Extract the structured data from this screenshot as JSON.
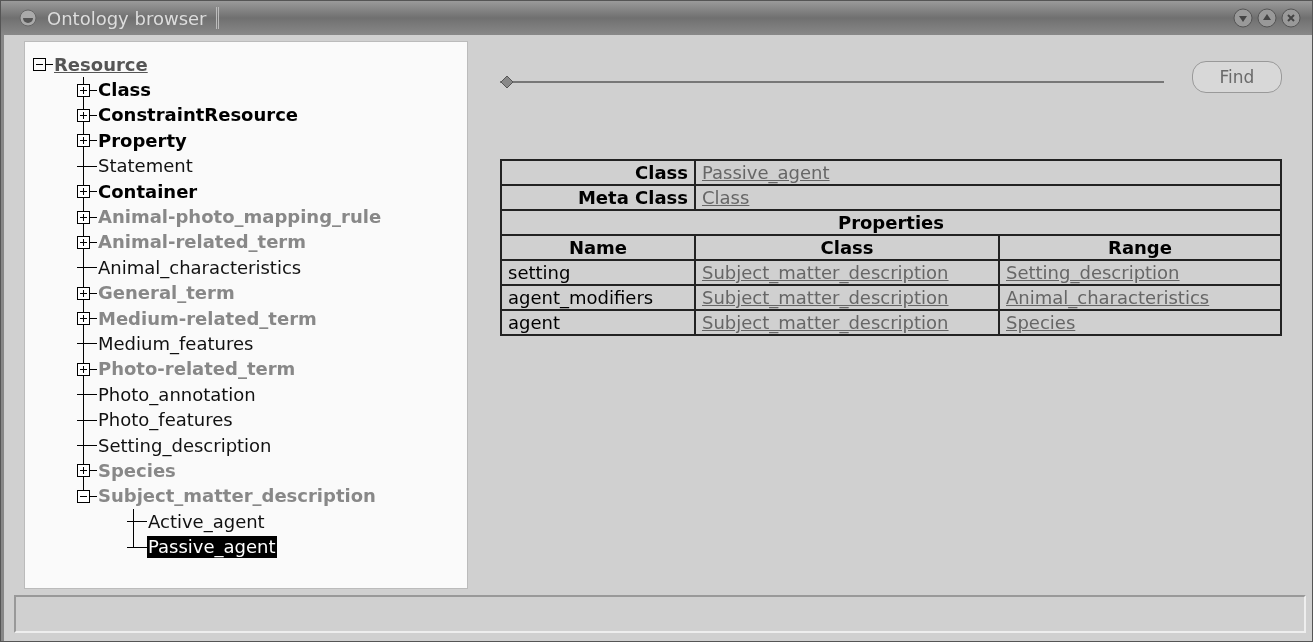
{
  "window": {
    "title": "Ontology browser"
  },
  "tree": {
    "label": "Resource",
    "expanded": true,
    "selected": false,
    "kind": "link",
    "children": [
      {
        "label": "Class",
        "kind": "bold",
        "expanded": false,
        "selected": false
      },
      {
        "label": "ConstraintResource",
        "kind": "bold",
        "expanded": false,
        "selected": false
      },
      {
        "label": "Property",
        "kind": "bold",
        "expanded": false,
        "selected": false
      },
      {
        "label": "Statement",
        "kind": "plain",
        "selected": false
      },
      {
        "label": "Container",
        "kind": "bold",
        "expanded": false,
        "selected": false
      },
      {
        "label": "Animal-photo_mapping_rule",
        "kind": "grey",
        "expanded": false,
        "selected": false
      },
      {
        "label": "Animal-related_term",
        "kind": "grey",
        "expanded": false,
        "selected": false
      },
      {
        "label": "Animal_characteristics",
        "kind": "plain",
        "selected": false
      },
      {
        "label": "General_term",
        "kind": "grey",
        "expanded": false,
        "selected": false
      },
      {
        "label": "Medium-related_term",
        "kind": "grey",
        "expanded": false,
        "selected": false
      },
      {
        "label": "Medium_features",
        "kind": "plain",
        "selected": false
      },
      {
        "label": "Photo-related_term",
        "kind": "grey",
        "expanded": false,
        "selected": false
      },
      {
        "label": "Photo_annotation",
        "kind": "plain",
        "selected": false
      },
      {
        "label": "Photo_features",
        "kind": "plain",
        "selected": false
      },
      {
        "label": "Setting_description",
        "kind": "plain",
        "selected": false
      },
      {
        "label": "Species",
        "kind": "grey",
        "expanded": false,
        "selected": false
      },
      {
        "label": "Subject_matter_description",
        "kind": "grey",
        "expanded": true,
        "selected": false,
        "children": [
          {
            "label": "Active_agent",
            "kind": "plain",
            "selected": false
          },
          {
            "label": "Passive_agent",
            "kind": "plain",
            "selected": true
          }
        ]
      }
    ]
  },
  "search": {
    "level": 0,
    "button": {
      "label": "Find",
      "disabled": true
    }
  },
  "details": {
    "class_label": "Class",
    "class_value": "Passive_agent",
    "meta_label": "Meta Class",
    "meta_value": "Class",
    "properties_label": "Properties",
    "columns": [
      "Name",
      "Class",
      "Range"
    ],
    "rows": [
      {
        "name": "setting",
        "class": "Subject_matter_description",
        "range": "Setting_description"
      },
      {
        "name": "agent_modifiers",
        "class": "Subject_matter_description",
        "range": "Animal_characteristics"
      },
      {
        "name": "agent",
        "class": "Subject_matter_description",
        "range": "Species"
      }
    ]
  }
}
